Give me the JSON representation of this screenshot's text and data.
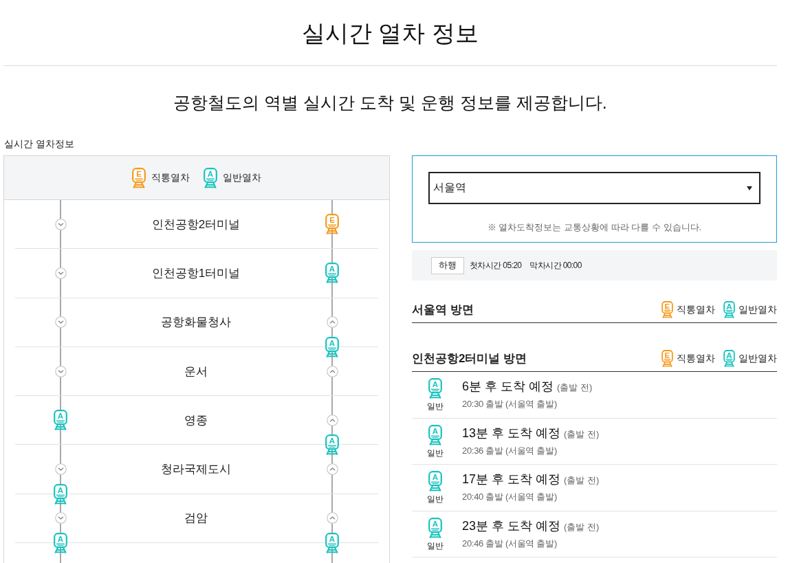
{
  "page": {
    "title": "실시간 열차 정보",
    "subtitle": "공항철도의 역별 실시간 도착 및 운행 정보를 제공합니다."
  },
  "section_label": "실시간 열차정보",
  "route_map": {
    "legend": [
      {
        "kind": "express",
        "badge": "E",
        "label": "직통열차"
      },
      {
        "kind": "normal",
        "badge": "A",
        "label": "일반열차"
      }
    ],
    "stations": [
      {
        "name": "인천공항2터미널",
        "right_track": {
          "train_at_station": {
            "kind": "express",
            "badge": "E"
          }
        }
      },
      {
        "name": "인천공항1터미널",
        "right_track": {
          "train_at_station": {
            "kind": "normal",
            "badge": "A"
          }
        }
      },
      {
        "name": "공항화물청사",
        "right_track": {
          "train_below": {
            "kind": "normal",
            "badge": "A"
          }
        }
      },
      {
        "name": "운서"
      },
      {
        "name": "영종",
        "left_track": {
          "train_at_station": {
            "kind": "normal",
            "badge": "A"
          }
        },
        "right_track": {
          "train_below": {
            "kind": "normal",
            "badge": "A"
          }
        }
      },
      {
        "name": "청라국제도시",
        "left_track": {
          "train_below": {
            "kind": "normal",
            "badge": "A"
          }
        }
      },
      {
        "name": "검암",
        "left_track": {
          "train_below": {
            "kind": "normal",
            "badge": "A"
          }
        },
        "right_track": {
          "train_below": {
            "kind": "normal",
            "badge": "A"
          }
        }
      }
    ]
  },
  "station_select": {
    "value": "서울역"
  },
  "notice": "※ 열차도착정보는 교통상황에 따라 다를 수 있습니다.",
  "schedule": {
    "direction_button": "하행",
    "first_train": "첫차시간 05:20",
    "last_train": "막차시간 00:00"
  },
  "directions": [
    {
      "title": "서울역 방면",
      "legend": [
        {
          "kind": "express",
          "badge": "E",
          "label": "직통열차"
        },
        {
          "kind": "normal",
          "badge": "A",
          "label": "일반열차"
        }
      ]
    },
    {
      "title": "인천공항2터미널 방면",
      "legend": [
        {
          "kind": "express",
          "badge": "E",
          "label": "직통열차"
        },
        {
          "kind": "normal",
          "badge": "A",
          "label": "일반열차"
        }
      ],
      "arrivals": [
        {
          "kind": "normal",
          "badge": "A",
          "type_label": "일반",
          "arrival": "6분 후 도착 예정",
          "status": "(출발 전)",
          "departure": "20:30 출발 (서울역 출발)"
        },
        {
          "kind": "normal",
          "badge": "A",
          "type_label": "일반",
          "arrival": "13분 후 도착 예정",
          "status": "(출발 전)",
          "departure": "20:36 출발 (서울역 출발)"
        },
        {
          "kind": "normal",
          "badge": "A",
          "type_label": "일반",
          "arrival": "17분 후 도착 예정",
          "status": "(출발 전)",
          "departure": "20:40 출발 (서울역 출발)"
        },
        {
          "kind": "normal",
          "badge": "A",
          "type_label": "일반",
          "arrival": "23분 후 도착 예정",
          "status": "(출발 전)",
          "departure": "20:46 출발 (서울역 출발)"
        }
      ]
    }
  ]
}
